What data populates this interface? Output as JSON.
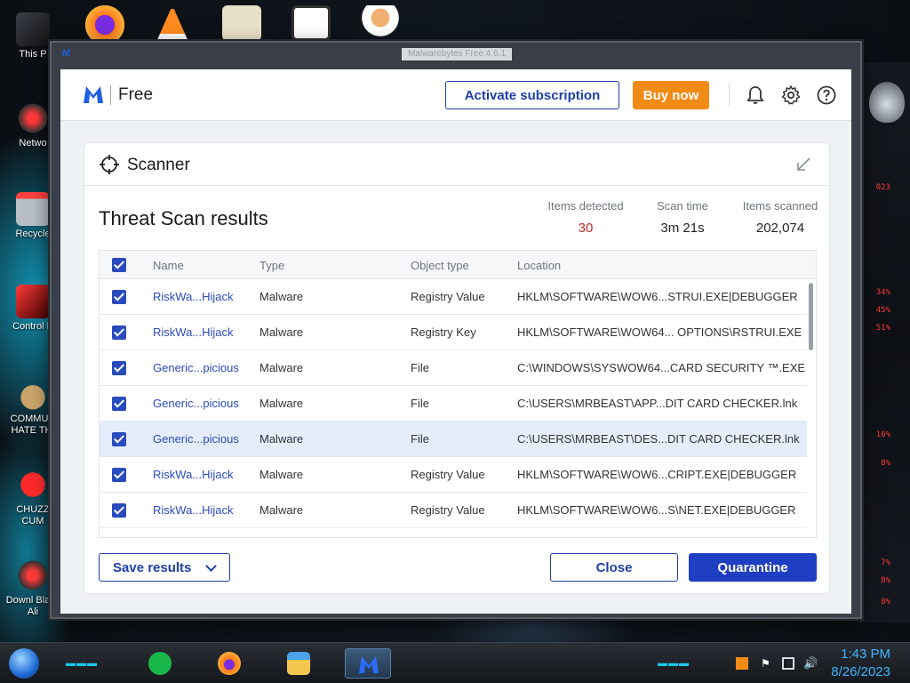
{
  "desktop": {
    "icons": [
      {
        "label": "This P"
      },
      {
        "label": "Netwo"
      },
      {
        "label": "Recycle"
      },
      {
        "label": "Control P"
      },
      {
        "label": "COMMUN HATE THI"
      },
      {
        "label": "CHUZZ CUM"
      },
      {
        "label": "Downl Black Ali"
      }
    ],
    "side_panel_readouts": [
      "023",
      "34%",
      "45%",
      "51%",
      "16%",
      "8%",
      "7%",
      "8%",
      "8%"
    ]
  },
  "window": {
    "title": "Malwarebytes Free  4.6.1"
  },
  "app": {
    "plan_label": "Free",
    "activate_label": "Activate subscription",
    "buy_label": "Buy now",
    "icons": [
      "bell-icon",
      "gear-icon",
      "help-icon"
    ]
  },
  "scanner": {
    "title": "Scanner",
    "results_title": "Threat Scan results",
    "stats": [
      {
        "label": "Items detected",
        "value": "30"
      },
      {
        "label": "Scan time",
        "value": "3m 21s"
      },
      {
        "label": "Items scanned",
        "value": "202,074"
      }
    ],
    "columns": {
      "name": "Name",
      "type": "Type",
      "object_type": "Object type",
      "location": "Location"
    },
    "rows": [
      {
        "name": "RiskWa...Hijack",
        "type": "Malware",
        "object_type": "Registry Value",
        "location": "HKLM\\SOFTWARE\\WOW6...STRUI.EXE|DEBUGGER"
      },
      {
        "name": "RiskWa...Hijack",
        "type": "Malware",
        "object_type": "Registry Key",
        "location": "HKLM\\SOFTWARE\\WOW64... OPTIONS\\RSTRUI.EXE"
      },
      {
        "name": "Generic...picious",
        "type": "Malware",
        "object_type": "File",
        "location": "C:\\WINDOWS\\SYSWOW64...CARD SECURITY ™.EXE"
      },
      {
        "name": "Generic...picious",
        "type": "Malware",
        "object_type": "File",
        "location": "C:\\USERS\\MRBEAST\\APP...DIT CARD CHECKER.lnk"
      },
      {
        "name": "Generic...picious",
        "type": "Malware",
        "object_type": "File",
        "location": "C:\\USERS\\MRBEAST\\DES...DIT CARD CHECKER.lnk"
      },
      {
        "name": "RiskWa...Hijack",
        "type": "Malware",
        "object_type": "Registry Value",
        "location": "HKLM\\SOFTWARE\\WOW6...CRIPT.EXE|DEBUGGER"
      },
      {
        "name": "RiskWa...Hijack",
        "type": "Malware",
        "object_type": "Registry Value",
        "location": "HKLM\\SOFTWARE\\WOW6...S\\NET.EXE|DEBUGGER"
      }
    ],
    "selected_row_index": 4,
    "save_label": "Save results",
    "close_label": "Close",
    "quarantine_label": "Quarantine"
  },
  "taskbar": {
    "time": "1:43 PM",
    "date": "8/26/2023"
  },
  "colors": {
    "accent": "#1f3fc2",
    "buy": "#f28a16",
    "detected": "#c62828",
    "clock": "#3fb6ff"
  }
}
